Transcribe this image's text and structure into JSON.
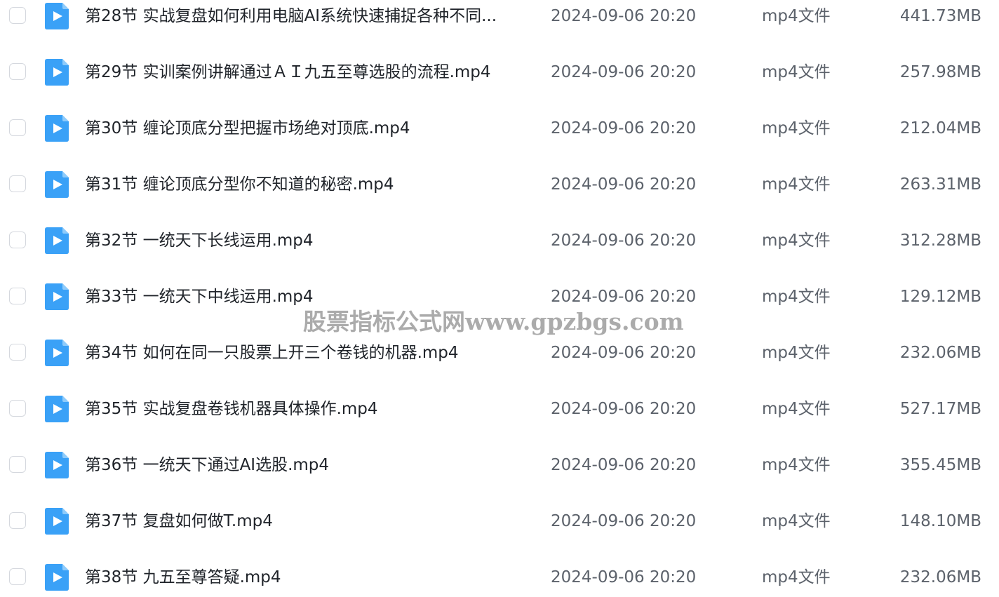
{
  "colors": {
    "icon_blue": "#3aa1f7",
    "icon_blue_fold": "#8ecbfb",
    "text_primary": "#1f2329",
    "text_secondary": "#5c626b",
    "checkbox_border": "#d5d8de"
  },
  "icons": {
    "file": "video-file-icon",
    "checkbox": "checkbox-unchecked"
  },
  "files": [
    {
      "name": "第28节 实战复盘如何利用电脑AI系统快速捕捉各种不同...",
      "date": "2024-09-06 20:20",
      "type": "mp4文件",
      "size": "441.73MB"
    },
    {
      "name": "第29节 实训案例讲解通过ＡＩ九五至尊选股的流程.mp4",
      "date": "2024-09-06 20:20",
      "type": "mp4文件",
      "size": "257.98MB"
    },
    {
      "name": "第30节 缠论顶底分型把握市场绝对顶底.mp4",
      "date": "2024-09-06 20:20",
      "type": "mp4文件",
      "size": "212.04MB"
    },
    {
      "name": "第31节 缠论顶底分型你不知道的秘密.mp4",
      "date": "2024-09-06 20:20",
      "type": "mp4文件",
      "size": "263.31MB"
    },
    {
      "name": "第32节 一统天下长线运用.mp4",
      "date": "2024-09-06 20:20",
      "type": "mp4文件",
      "size": "312.28MB"
    },
    {
      "name": "第33节 一统天下中线运用.mp4",
      "date": "2024-09-06 20:20",
      "type": "mp4文件",
      "size": "129.12MB"
    },
    {
      "name": "第34节 如何在同一只股票上开三个卷钱的机器.mp4",
      "date": "2024-09-06 20:20",
      "type": "mp4文件",
      "size": "232.06MB"
    },
    {
      "name": "第35节 实战复盘卷钱机器具体操作.mp4",
      "date": "2024-09-06 20:20",
      "type": "mp4文件",
      "size": "527.17MB"
    },
    {
      "name": "第36节 一统天下通过AI选股.mp4",
      "date": "2024-09-06 20:20",
      "type": "mp4文件",
      "size": "355.45MB"
    },
    {
      "name": "第37节 复盘如何做T.mp4",
      "date": "2024-09-06 20:20",
      "type": "mp4文件",
      "size": "148.10MB"
    },
    {
      "name": "第38节 九五至尊答疑.mp4",
      "date": "2024-09-06 20:20",
      "type": "mp4文件",
      "size": "232.06MB"
    }
  ],
  "watermark": "股票指标公式网www.gpzbgs.com"
}
